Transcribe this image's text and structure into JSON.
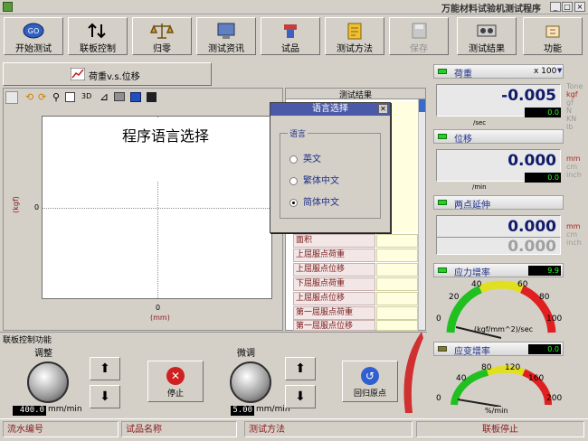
{
  "window": {
    "title": "万能材料试验机测试程序"
  },
  "toolbar": {
    "buttons": [
      {
        "label": "开始测试",
        "icon": "go-icon"
      },
      {
        "label": "联板控制",
        "icon": "updown-arrows-icon"
      },
      {
        "label": "归零",
        "icon": "balance-icon"
      },
      {
        "label": "测试资讯",
        "icon": "monitor-icon"
      },
      {
        "label": "试品",
        "icon": "specimen-icon"
      },
      {
        "label": "测试方法",
        "icon": "method-icon"
      },
      {
        "label": "保存",
        "icon": "save-icon"
      },
      {
        "label": "测试结果",
        "icon": "results-icon"
      },
      {
        "label": "功能",
        "icon": "function-icon"
      }
    ]
  },
  "graph": {
    "mode_label": "荷重v.s.位移",
    "toolbar_3d": "3D",
    "overlay_text": "程序语言选择",
    "y_label": "(kgf)",
    "x_label": "(mm)",
    "y_zero": "0",
    "x_zero": "0"
  },
  "results": {
    "header": "测试结果",
    "rows": [
      "面积",
      "上屈服点荷重",
      "上屈服点位移",
      "下屈服点荷重",
      "上屈服点位移",
      "第一屈服点荷重",
      "第一屈服点位移"
    ]
  },
  "dialog": {
    "title": "语言选择",
    "group_label": "语言",
    "options": [
      {
        "label": "英文",
        "selected": false
      },
      {
        "label": "繁体中文",
        "selected": false
      },
      {
        "label": "简体中文",
        "selected": true
      }
    ]
  },
  "control": {
    "title": "联板控制功能",
    "adjust_label": "调整",
    "adjust_value": "400.0",
    "fine_label": "微调",
    "fine_value": "5.00",
    "unit": "mm/min",
    "stop_label": "停止",
    "home_label": "回归原点"
  },
  "panel": {
    "load": {
      "title": "荷重",
      "scale": "x 100",
      "value": "-0.005",
      "unit": "/sec",
      "peak": "0.0",
      "units": [
        "Tone",
        "kgf",
        "gf",
        "N",
        "KN",
        "lb"
      ]
    },
    "position": {
      "title": "位移",
      "value": "0.000",
      "unit": "/min",
      "peak": "0.0",
      "units": [
        "mm",
        "cm",
        "inch"
      ]
    },
    "elongation": {
      "title": "两点延伸",
      "value": "0.000",
      "sub_value": "0.000",
      "units": [
        "mm",
        "cm",
        "inch"
      ]
    },
    "stress_rate": {
      "title": "应力增率",
      "value": "9.9",
      "ticks": [
        "0",
        "20",
        "40",
        "60",
        "80",
        "100"
      ],
      "unit": "(kgf/mm^2)/sec"
    },
    "strain_rate": {
      "title": "应变增率",
      "value": "0.0",
      "ticks": [
        "0",
        "40",
        "80",
        "120",
        "160",
        "200"
      ],
      "unit": "%/min"
    }
  },
  "status": {
    "serial_label": "流水编号",
    "specimen_label": "试品名称",
    "method_label": "测试方法",
    "state": "联板停止"
  },
  "colors": {
    "accent": "#20308a",
    "led_green": "#2acc2a",
    "red_text": "#8a1a1a"
  }
}
